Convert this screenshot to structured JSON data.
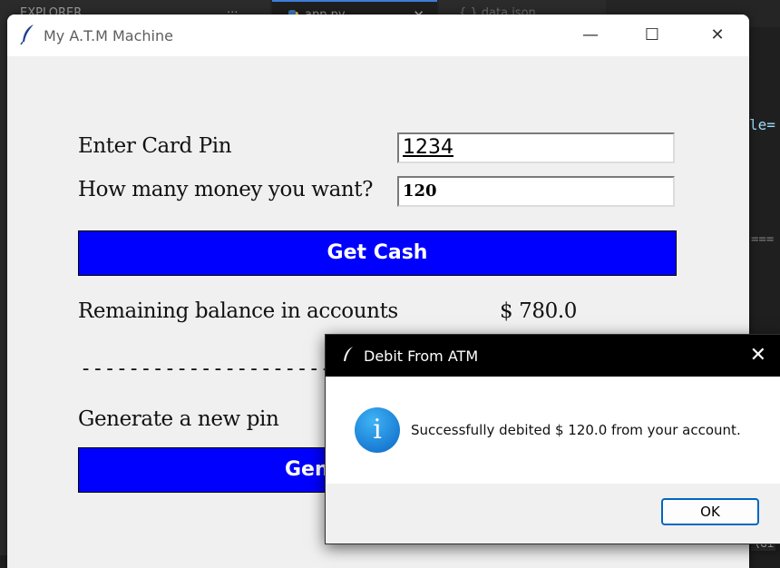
{
  "background_editor": {
    "tab1_label": "EXPLORER",
    "tab1_more": "···",
    "tab2_label": "app.py",
    "tab3_label": "{ } data.json",
    "code_fragment_1": "le=",
    "code_fragment_2": "===",
    "code_fragment_3": "\\Gi"
  },
  "window": {
    "title": "My A.T.M Machine",
    "controls": {
      "minimize": "—",
      "maximize": "☐",
      "close": "✕"
    }
  },
  "form": {
    "pin_label": "Enter Card Pin",
    "pin_value": "1234",
    "amount_label": "How many money you want?",
    "amount_value": "120",
    "get_cash_button": "Get Cash",
    "balance_label": "Remaining balance in accounts",
    "balance_value": "$ 780.0",
    "separator": "------------------------------------------------",
    "new_pin_label": "Generate a new pin",
    "generate_button_visible": "Gen"
  },
  "dialog": {
    "title": "Debit From ATM",
    "close": "✕",
    "icon_glyph": "i",
    "message": "Successfully debited $ 120.0 from your account.",
    "ok_button": "OK"
  },
  "colors": {
    "button_blue": "#0000ff",
    "ok_border": "#0067c0",
    "dialog_titlebar": "#000000",
    "window_bg": "#f0f0f0"
  },
  "icons": {
    "window_icon": "tk-feather-icon",
    "dialog_icon": "info-icon"
  }
}
